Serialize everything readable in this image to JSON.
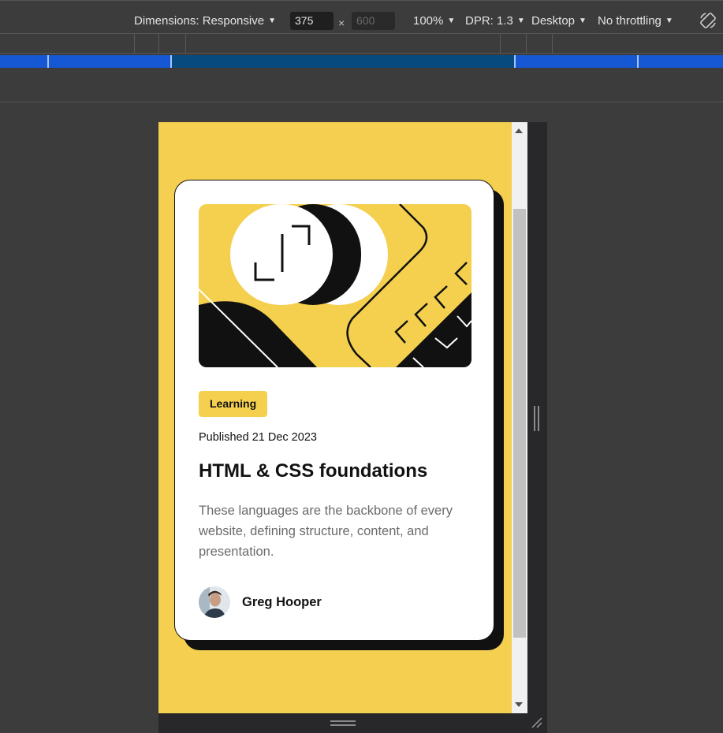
{
  "devtools": {
    "dimensions_label": "Dimensions: Responsive",
    "width_value": "375",
    "height_placeholder": "600",
    "times": "×",
    "zoom": "100%",
    "dpr": "DPR: 1.3",
    "device_mode": "Desktop",
    "throttling": "No throttling",
    "caret": "▼"
  },
  "card": {
    "tag": "Learning",
    "published": "Published 21 Dec 2023",
    "title": "HTML & CSS foundations",
    "description": "These languages are the backbone of every website, defining structure, content, and presentation.",
    "author": "Greg Hooper"
  },
  "colors": {
    "page_bg": "#f4cf50",
    "tag_bg": "#f4d04e",
    "text": "#111111",
    "muted": "#6b6b6b",
    "devtools_bg": "#3c3c3c",
    "media_query_bar": "#1658d3"
  }
}
